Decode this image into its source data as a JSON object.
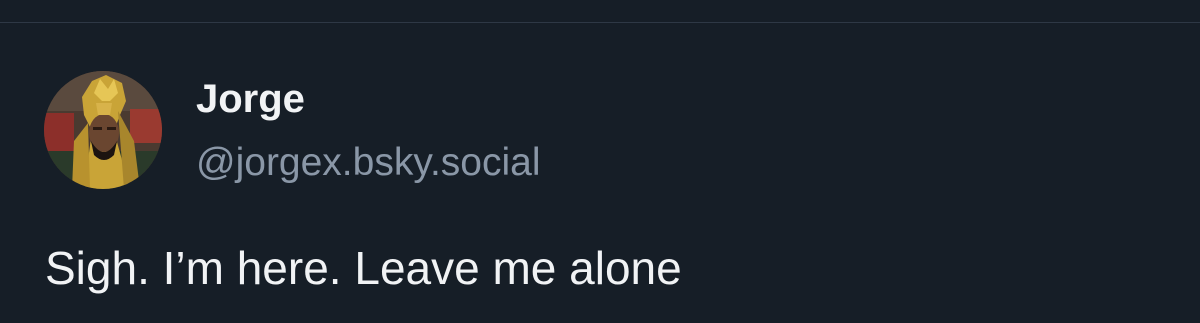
{
  "post": {
    "author": {
      "display_name": "Jorge",
      "handle": "@jorgex.bsky.social",
      "avatar": "avatar-image"
    },
    "text": "Sigh. I’m here. Leave me alone"
  },
  "colors": {
    "background": "#161e27",
    "divider": "#2e3845",
    "primary_text": "#f1f3f5",
    "secondary_text": "#8a97a7"
  }
}
